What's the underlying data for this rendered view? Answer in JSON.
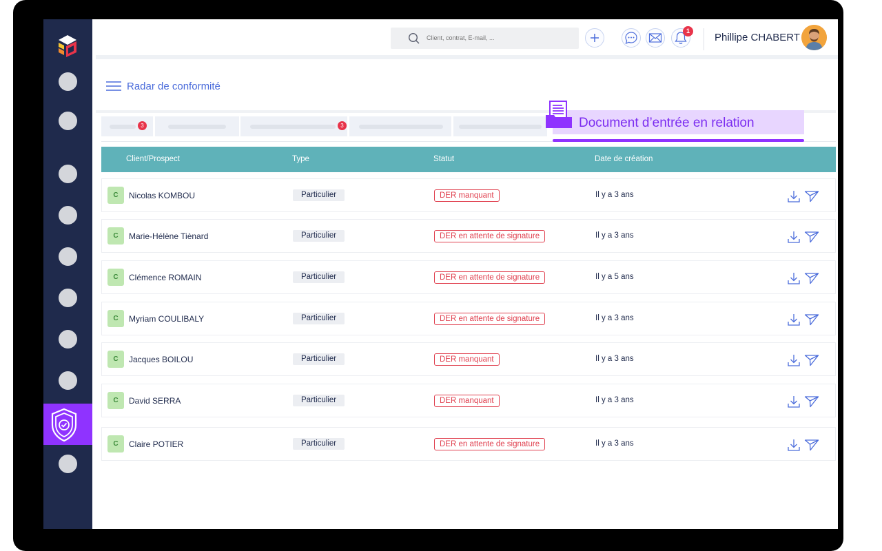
{
  "colors": {
    "sidebar": "#1f2a4c",
    "accent_purple": "#8f33ff",
    "table_header": "#5fb2b9",
    "status_red": "#e0404f",
    "link_blue": "#4b6cdb",
    "badge_green": "#bfe7b1"
  },
  "topbar": {
    "search_placeholder": "Client, contrat, E-mail, ...",
    "notification_count": "1",
    "user_name": "Phillipe CHABERT",
    "icons": [
      "search-icon",
      "plus-icon",
      "chat-icon",
      "mail-icon",
      "bell-icon"
    ]
  },
  "page": {
    "title": "Radar de conformité"
  },
  "tabs": {
    "badges": [
      "3",
      "3"
    ],
    "active_label": "Document d’entrée en relation"
  },
  "table": {
    "headers": [
      "Client/Prospect",
      "Type",
      "Statut",
      "Date de création"
    ],
    "rows": [
      {
        "initial": "C",
        "name": "Nicolas KOMBOU",
        "type": "Particulier",
        "status": "DER manquant",
        "date": "Il y a 3 ans"
      },
      {
        "initial": "C",
        "name": "Marie-Hélène Tiènard",
        "type": "Particulier",
        "status": "DER en attente de signature",
        "date": "Il y a 3 ans"
      },
      {
        "initial": "C",
        "name": "Clémence ROMAIN",
        "type": "Particulier",
        "status": "DER en attente de signature",
        "date": "Il y a 5 ans"
      },
      {
        "initial": "C",
        "name": "Myriam COULIBALY",
        "type": "Particulier",
        "status": "DER en attente de signature",
        "date": "Il y a 3 ans"
      },
      {
        "initial": "C",
        "name": "Jacques BOILOU",
        "type": "Particulier",
        "status": "DER manquant",
        "date": "Il y a 3 ans"
      },
      {
        "initial": "C",
        "name": "David SERRA",
        "type": "Particulier",
        "status": "DER manquant",
        "date": "Il y a 3 ans"
      },
      {
        "initial": "C",
        "name": "Claire POTIER",
        "type": "Particulier",
        "status": "DER en attente de signature",
        "date": "Il y a 3 ans"
      }
    ]
  }
}
